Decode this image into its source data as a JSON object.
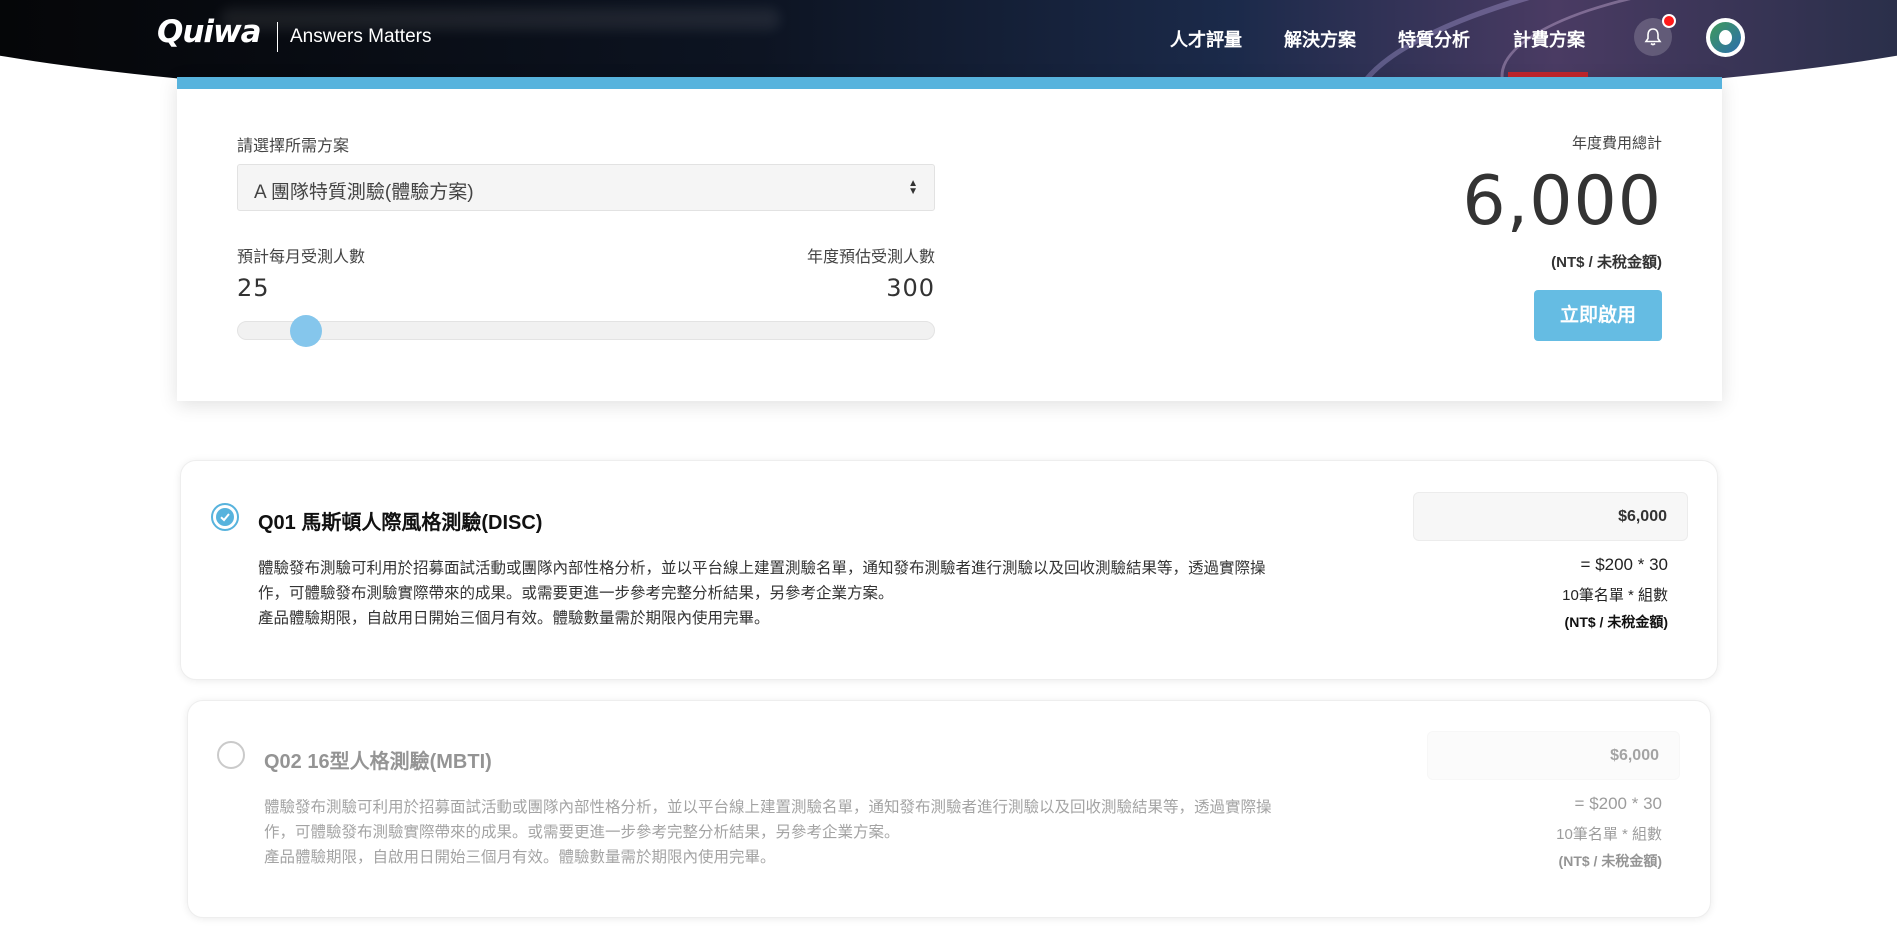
{
  "header": {
    "logo": "Quiwa",
    "tagline": "Answers Matters",
    "nav": [
      {
        "label": "人才評量"
      },
      {
        "label": "解決方案"
      },
      {
        "label": "特質分析"
      },
      {
        "label": "計費方案",
        "active": true
      }
    ],
    "notification": true
  },
  "calculator": {
    "plan_label": "請選擇所需方案",
    "plan_selected": "A 團隊特質測驗(體驗方案)",
    "monthly_label": "預計每月受測人數",
    "monthly_value": "25",
    "annual_label": "年度預估受測人數",
    "annual_value": "300",
    "slider_fraction": 0.08,
    "total_label": "年度費用總計",
    "total_value": "6,000",
    "total_unit": "(NT$ / 未稅金額)",
    "start_button": "立即啟用",
    "accent_color": "#57b3dd"
  },
  "products": [
    {
      "code_title": "Q01 馬斯頓人際風格測驗(DISC)",
      "checked": true,
      "desc_1": "體驗發布測驗可利用於招募面試活動或團隊內部性格分析，並以平台線上建置測驗名單，通知發布測驗者進行測驗以及回收測驗結果等，透過實際操作，可體驗發布測驗實際帶來的成果。或需要更進一步參考完整分析結果，另參考企業方案。",
      "desc_2": "產品體驗期限，自啟用日開始三個月有效。體驗數量需於期限內使用完畢。",
      "price": "$6,000",
      "formula": "= $200 * 30",
      "count_label": "10筆名單 * 組數",
      "tax_label": "(NT$ / 未稅金額)"
    },
    {
      "code_title": "Q02 16型人格測驗(MBTI)",
      "checked": false,
      "desc_1": "體驗發布測驗可利用於招募面試活動或團隊內部性格分析，並以平台線上建置測驗名單，通知發布測驗者進行測驗以及回收測驗結果等，透過實際操作，可體驗發布測驗實際帶來的成果。或需要更進一步參考完整分析結果，另參考企業方案。",
      "desc_2": "產品體驗期限，自啟用日開始三個月有效。體驗數量需於期限內使用完畢。",
      "price": "$6,000",
      "formula": "= $200 * 30",
      "count_label": "10筆名單 * 組數",
      "tax_label": "(NT$ / 未稅金額)"
    }
  ]
}
